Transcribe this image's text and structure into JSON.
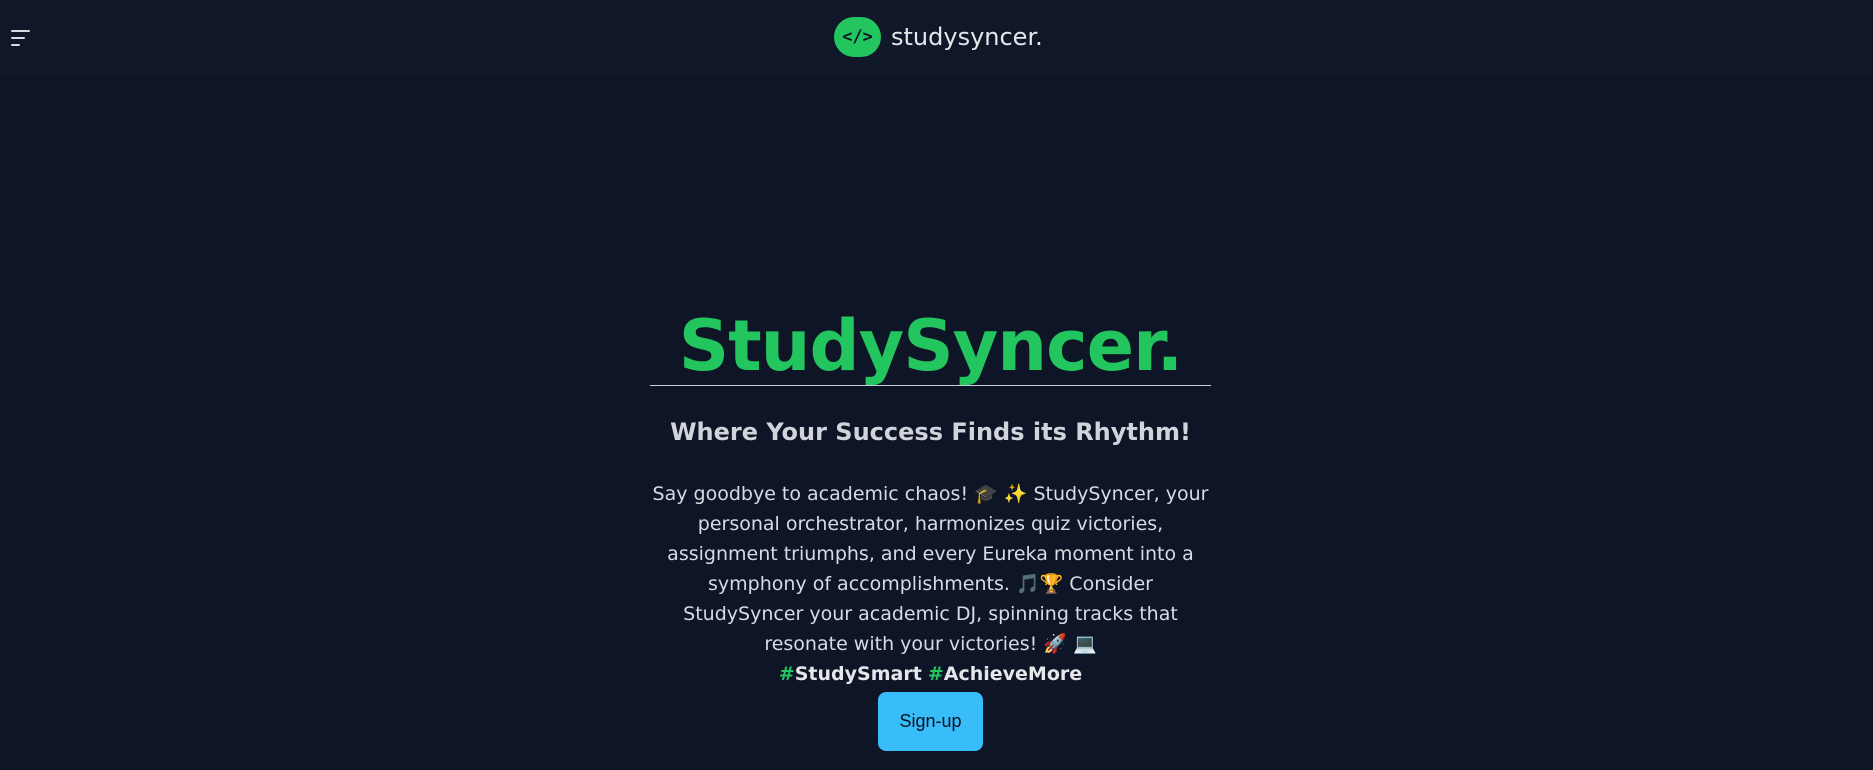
{
  "navbar": {
    "brand_logo_text": "</>",
    "brand_name": "studysyncer.",
    "menu_icon": "hamburger-menu-icon"
  },
  "hero": {
    "title": "StudySyncer.",
    "subtitle": "Where Your Success Finds its Rhythm!",
    "description": "Say goodbye to academic chaos! 🎓 ✨ StudySyncer, your personal orchestrator, harmonizes quiz victories, assignment triumphs, and every Eureka moment into a symphony of accomplishments. 🎵🏆 Consider StudySyncer your academic DJ, spinning tracks that resonate with your victories! 🚀 💻",
    "hashtags": [
      {
        "hash": "#",
        "tag": "StudySmart"
      },
      {
        "hash": "#",
        "tag": "AchieveMore"
      }
    ],
    "cta_label": "Sign-up"
  },
  "colors": {
    "background": "#0e1526",
    "navbar": "#0f1729",
    "accent_green": "#22c55e",
    "cta_blue": "#38bdf8"
  }
}
